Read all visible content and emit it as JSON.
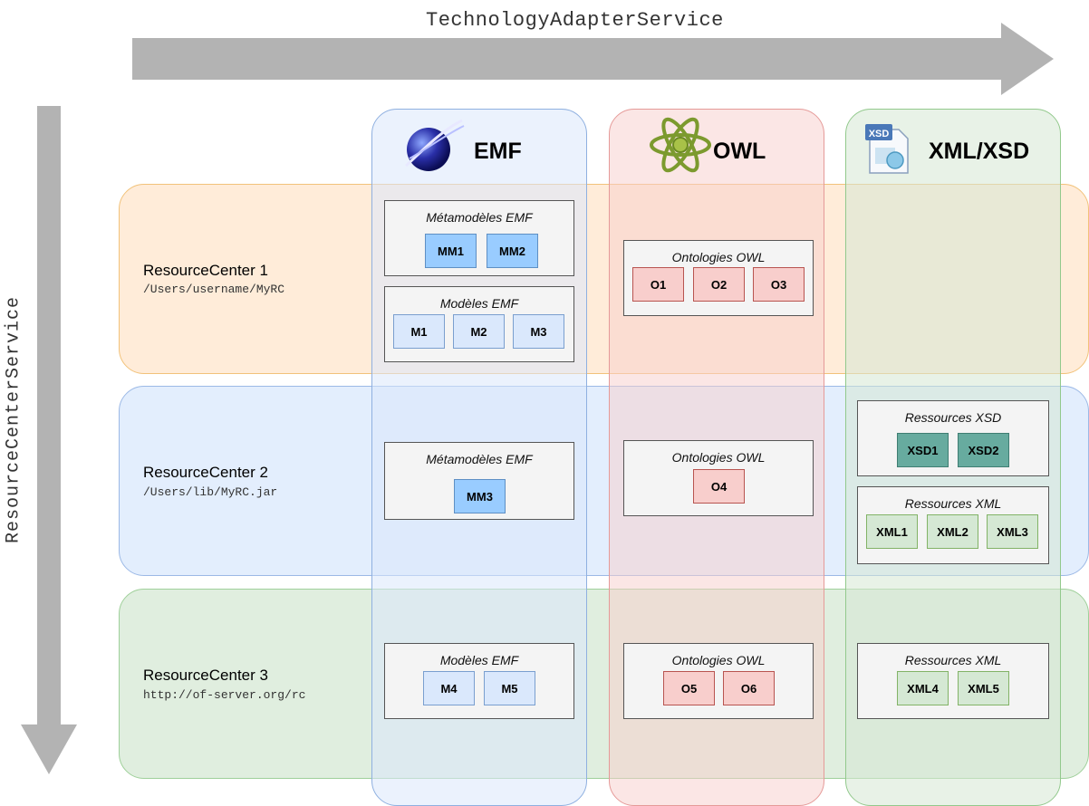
{
  "arrows": {
    "horizontal_label": "TechnologyAdapterService",
    "vertical_label": "ResourceCenterService"
  },
  "columns": {
    "emf": "EMF",
    "owl": "OWL",
    "xml": "XML/XSD"
  },
  "rows": [
    {
      "name": "ResourceCenter 1",
      "path": "/Users/username/MyRC"
    },
    {
      "name": "ResourceCenter 2",
      "path": "/Users/lib/MyRC.jar"
    },
    {
      "name": "ResourceCenter 3",
      "path": "http://of-server.org/rc"
    }
  ],
  "groups": {
    "r1_emf_mm": {
      "title": "Métamodèles EMF",
      "items": [
        "MM1",
        "MM2"
      ]
    },
    "r1_emf_m": {
      "title": "Modèles EMF",
      "items": [
        "M1",
        "M2",
        "M3"
      ]
    },
    "r1_owl": {
      "title": "Ontologies OWL",
      "items": [
        "O1",
        "O2",
        "O3"
      ]
    },
    "r2_emf_mm": {
      "title": "Métamodèles EMF",
      "items": [
        "MM3"
      ]
    },
    "r2_owl": {
      "title": "Ontologies OWL",
      "items": [
        "O4"
      ]
    },
    "r2_xsd": {
      "title": "Ressources XSD",
      "items": [
        "XSD1",
        "XSD2"
      ]
    },
    "r2_xml": {
      "title": "Ressources XML",
      "items": [
        "XML1",
        "XML2",
        "XML3"
      ]
    },
    "r3_emf_m": {
      "title": "Modèles EMF",
      "items": [
        "M4",
        "M5"
      ]
    },
    "r3_owl": {
      "title": "Ontologies OWL",
      "items": [
        "O5",
        "O6"
      ]
    },
    "r3_xml": {
      "title": "Ressources XML",
      "items": [
        "XML4",
        "XML5"
      ]
    }
  },
  "colors": {
    "arrow": "#b3b3b3",
    "metamodel": "#99ccff",
    "model": "#dae8fc",
    "ontology": "#f8cecc",
    "xsd": "#67ab9f",
    "xml": "#d5e8d4"
  },
  "icons": {
    "emf": "emf-logo-icon",
    "owl": "owl-atom-icon",
    "xml": "xsd-document-icon"
  }
}
